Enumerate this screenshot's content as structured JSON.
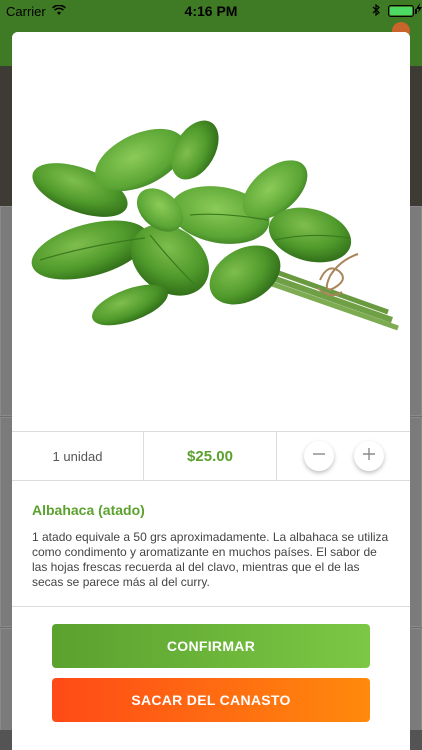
{
  "status_bar": {
    "carrier": "Carrier",
    "time": "4:16 PM",
    "battery_color": "#4cd964"
  },
  "product": {
    "image_alt": "basil bunch",
    "quantity_label": "1 unidad",
    "price": "$25.00",
    "title": "Albahaca (atado)",
    "description": "1 atado equivale a 50 grs aproximadamente. La albahaca se utiliza como condimento y aromatizante en muchos países. El sabor de las hojas frescas recuerda al del clavo, mientras que el de las secas se parece más al del curry."
  },
  "stepper": {
    "decrement_icon": "minus-icon",
    "increment_icon": "plus-icon"
  },
  "actions": {
    "confirm_label": "CONFIRMAR",
    "remove_label": "SACAR DEL CANASTO"
  },
  "colors": {
    "accent_green": "#5aa12e",
    "confirm_gradient": [
      "#5aa12e",
      "#7cc845"
    ],
    "remove_gradient": [
      "#ff4a17",
      "#ff8a0c"
    ]
  }
}
